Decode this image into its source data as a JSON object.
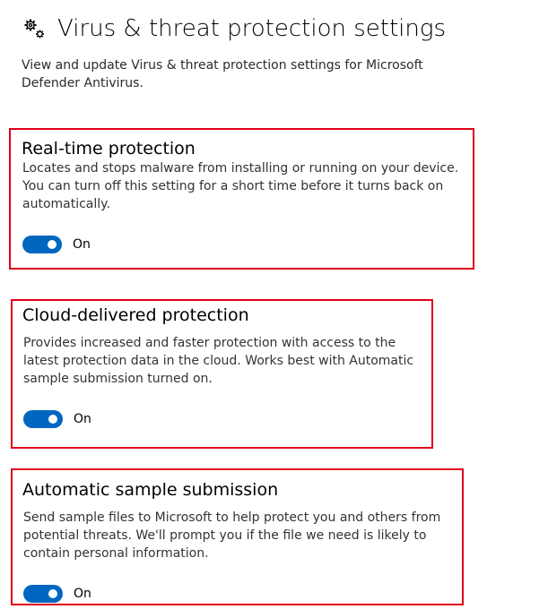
{
  "header": {
    "icon": "gears-icon",
    "title": "Virus & threat protection settings",
    "description": "View and update Virus & threat protection settings for Microsoft Defender Antivirus."
  },
  "sections": [
    {
      "title": "Real-time protection",
      "description": "Locates and stops malware from installing or running on your device. You can turn off this setting for a short time before it turns back on automatically.",
      "toggle_state": "On",
      "toggle_on": true
    },
    {
      "title": "Cloud-delivered protection",
      "description": "Provides increased and faster protection with access to the latest protection data in the cloud. Works best with Automatic sample submission turned on.",
      "toggle_state": "On",
      "toggle_on": true
    },
    {
      "title": "Automatic sample submission",
      "description": "Send sample files to Microsoft to help protect you and others from potential threats. We'll prompt you if the file we need is likely to contain personal information.",
      "toggle_state": "On",
      "toggle_on": true
    }
  ],
  "colors": {
    "toggle_on": "#0067c0",
    "highlight_border": "#e0001b"
  }
}
